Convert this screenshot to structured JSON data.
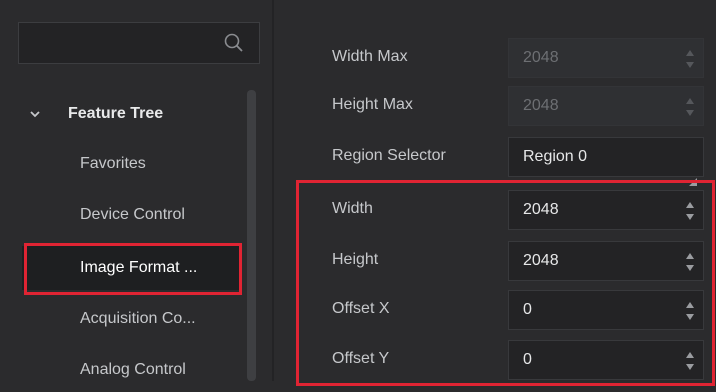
{
  "search": {
    "placeholder": "",
    "icon": "search-icon"
  },
  "feature_tree": {
    "header": "Feature Tree",
    "items": [
      {
        "label": "Favorites"
      },
      {
        "label": "Device Control"
      },
      {
        "label": "Image Format ..."
      },
      {
        "label": "Acquisition Co..."
      },
      {
        "label": "Analog Control"
      }
    ],
    "selected_index": 2
  },
  "properties": [
    {
      "label": "Width Max",
      "value": "2048",
      "disabled": true,
      "control": "spin"
    },
    {
      "label": "Height Max",
      "value": "2048",
      "disabled": true,
      "control": "spin"
    },
    {
      "label": "Region Selector",
      "value": "Region 0",
      "disabled": false,
      "control": "dropdown"
    },
    {
      "label": "Width",
      "value": "2048",
      "disabled": false,
      "control": "spin"
    },
    {
      "label": "Height",
      "value": "2048",
      "disabled": false,
      "control": "spin"
    },
    {
      "label": "Offset X",
      "value": "0",
      "disabled": false,
      "control": "spin"
    },
    {
      "label": "Offset Y",
      "value": "0",
      "disabled": false,
      "control": "spin"
    }
  ],
  "colors": {
    "highlight": "#e02433",
    "background": "#2b2b2d",
    "field": "#232325"
  }
}
